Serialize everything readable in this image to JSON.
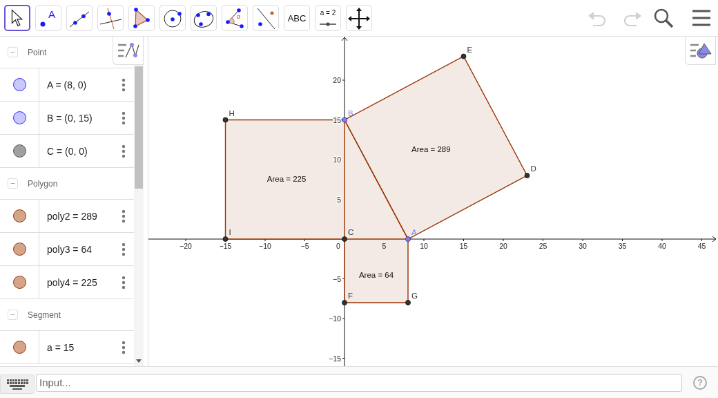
{
  "toolbar": {
    "tools": [
      {
        "kind": "move",
        "selected": true
      },
      {
        "kind": "point",
        "label": "A",
        "selected": false
      },
      {
        "kind": "line",
        "selected": false
      },
      {
        "kind": "perpendicular",
        "selected": false
      },
      {
        "kind": "polygon",
        "selected": false
      },
      {
        "kind": "circle-center",
        "selected": false
      },
      {
        "kind": "circle-three",
        "selected": false
      },
      {
        "kind": "angle",
        "label": "α",
        "selected": false
      },
      {
        "kind": "reflect",
        "selected": false
      },
      {
        "kind": "text",
        "label": "ABC",
        "selected": false
      },
      {
        "kind": "slider",
        "label": "a = 2",
        "selected": false
      },
      {
        "kind": "move-view",
        "selected": false
      }
    ],
    "actions": [
      {
        "kind": "undo",
        "disabled": true
      },
      {
        "kind": "redo",
        "disabled": true
      },
      {
        "kind": "search",
        "disabled": false
      },
      {
        "kind": "menu",
        "disabled": false
      }
    ]
  },
  "algebra": {
    "groups": [
      {
        "label": "Point",
        "expanded": true,
        "items": [
          {
            "text": "A = (8, 0)",
            "color": "#c8c8ff"
          },
          {
            "text": "B = (0, 15)",
            "color": "#c8c8ff"
          },
          {
            "text": "C = (0, 0)",
            "color": "#a0a0a0"
          }
        ]
      },
      {
        "label": "Polygon",
        "expanded": true,
        "items": [
          {
            "text": "poly2 = 289",
            "color": "#d6a589"
          },
          {
            "text": "poly3 = 64",
            "color": "#d6a589"
          },
          {
            "text": "poly4 = 225",
            "color": "#d6a589"
          }
        ]
      },
      {
        "label": "Segment",
        "expanded": true,
        "items": [
          {
            "text": "a = 15",
            "color": "#d6a589"
          }
        ]
      }
    ]
  },
  "graphics": {
    "x_ticks": [
      "−20",
      "−15",
      "−10",
      "−5",
      "0",
      "5",
      "10",
      "15",
      "20",
      "25",
      "30",
      "35",
      "40",
      "45"
    ],
    "y_ticks": [
      "20",
      "15",
      "10",
      "5",
      "−5",
      "−10",
      "−15"
    ],
    "points": [
      {
        "label": "A",
        "kind": "free"
      },
      {
        "label": "B",
        "kind": "free"
      },
      {
        "label": "C",
        "kind": "dependent"
      },
      {
        "label": "D",
        "kind": "dependent"
      },
      {
        "label": "E",
        "kind": "dependent"
      },
      {
        "label": "F",
        "kind": "dependent"
      },
      {
        "label": "G",
        "kind": "dependent"
      },
      {
        "label": "H",
        "kind": "dependent"
      },
      {
        "label": "I",
        "kind": "dependent"
      }
    ],
    "polygons": [
      {
        "caption": "Area = 289"
      },
      {
        "caption": "Area = 64"
      },
      {
        "caption": "Area = 225"
      }
    ]
  },
  "input_bar": {
    "placeholder": "Input...",
    "help": "?"
  }
}
